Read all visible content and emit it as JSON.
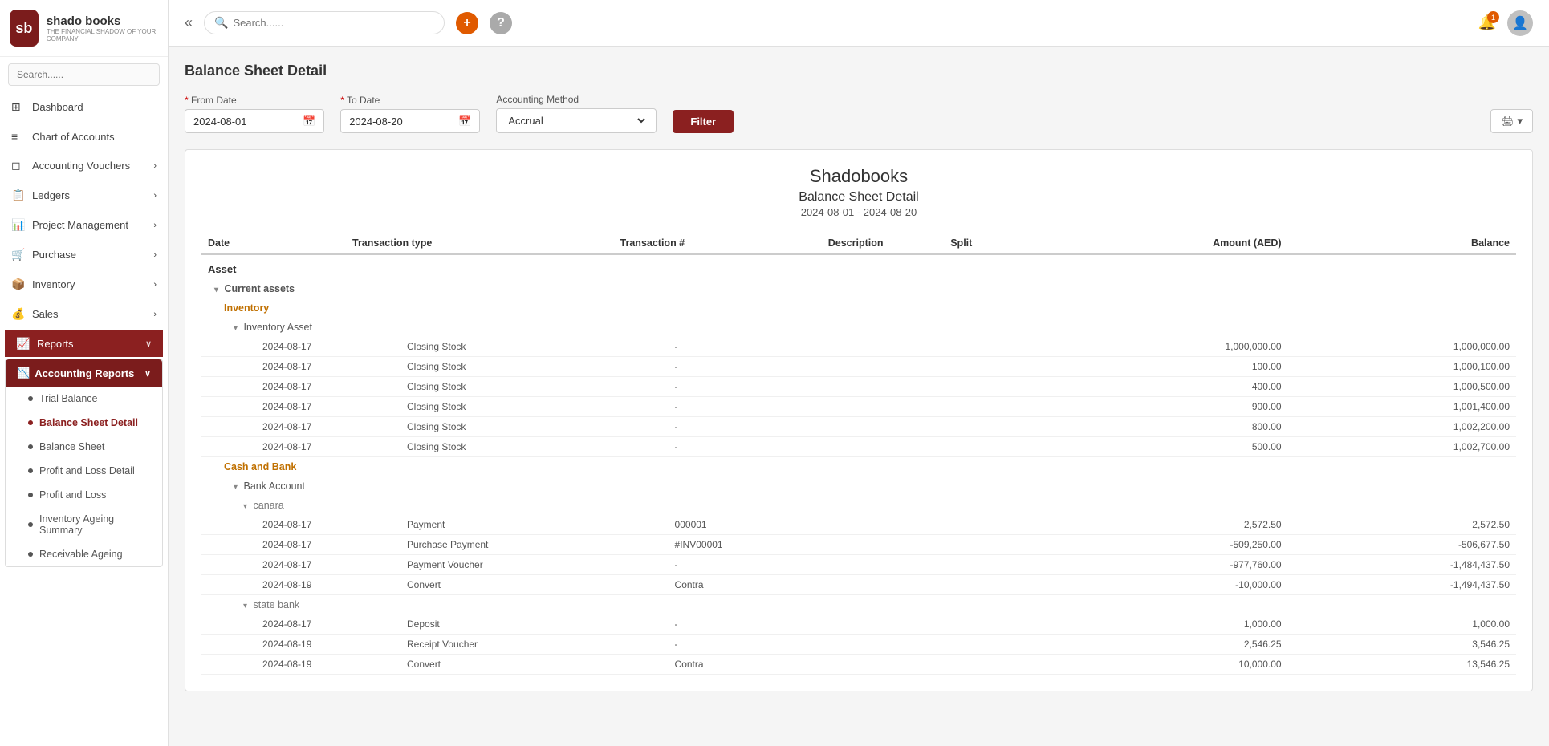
{
  "app": {
    "logo_initials": "sb",
    "logo_brand": "shado books",
    "logo_tagline": "THE FINANCIAL SHADOW OF YOUR COMPANY"
  },
  "sidebar": {
    "search_placeholder": "Search......",
    "nav_items": [
      {
        "id": "dashboard",
        "icon": "⊞",
        "label": "Dashboard",
        "active": false
      },
      {
        "id": "chart-of-accounts",
        "icon": "≡",
        "label": "Chart of Accounts",
        "active": false
      },
      {
        "id": "accounting-vouchers",
        "icon": "☐",
        "label": "Accounting Vouchers",
        "has_chevron": true,
        "active": false
      },
      {
        "id": "ledgers",
        "icon": "📋",
        "label": "Ledgers",
        "has_chevron": true,
        "active": false
      },
      {
        "id": "project-management",
        "icon": "📊",
        "label": "Project Management",
        "has_chevron": true,
        "active": false
      },
      {
        "id": "purchase",
        "icon": "🛒",
        "label": "Purchase",
        "has_chevron": true,
        "active": false
      },
      {
        "id": "inventory",
        "icon": "📦",
        "label": "Inventory",
        "has_chevron": true,
        "active": false
      },
      {
        "id": "sales",
        "icon": "💰",
        "label": "Sales",
        "has_chevron": true,
        "active": false
      },
      {
        "id": "reports",
        "icon": "📈",
        "label": "Reports",
        "has_chevron": true,
        "active": true
      }
    ],
    "accounting_reports": {
      "label": "Accounting Reports",
      "items": [
        {
          "id": "trial-balance",
          "label": "Trial Balance",
          "active": false
        },
        {
          "id": "balance-sheet-detail",
          "label": "Balance Sheet Detail",
          "active": true
        },
        {
          "id": "balance-sheet",
          "label": "Balance Sheet",
          "active": false
        },
        {
          "id": "profit-loss-detail",
          "label": "Profit and Loss Detail",
          "active": false
        },
        {
          "id": "profit-loss",
          "label": "Profit and Loss",
          "active": false
        },
        {
          "id": "inventory-ageing",
          "label": "Inventory Ageing Summary",
          "active": false
        },
        {
          "id": "receivable-ageing",
          "label": "Receivable Ageing",
          "active": false
        }
      ]
    }
  },
  "topbar": {
    "search_placeholder": "Search......",
    "notif_count": "1"
  },
  "page": {
    "title": "Balance Sheet Detail",
    "filter": {
      "from_date_label": "From Date",
      "from_date_value": "2024-08-01",
      "to_date_label": "To Date",
      "to_date_value": "2024-08-20",
      "accounting_method_label": "Accounting Method",
      "accounting_method_value": "Accrual",
      "filter_btn": "Filter",
      "print_btn": "🖨"
    },
    "report": {
      "company": "Shadobooks",
      "title": "Balance Sheet Detail",
      "period": "2024-08-01 - 2024-08-20",
      "columns": [
        "Date",
        "Transaction type",
        "Transaction #",
        "Description",
        "Split",
        "Amount (AED)",
        "Balance"
      ],
      "sections": [
        {
          "type": "section-header",
          "label": "Asset"
        },
        {
          "type": "sub-section",
          "label": "Current assets",
          "collapse": true
        },
        {
          "type": "group-header",
          "label": "Inventory",
          "color": "orange"
        },
        {
          "type": "sub-group",
          "label": "Inventory Asset",
          "collapse": true
        },
        {
          "type": "data-row",
          "date": "2024-08-17",
          "tx_type": "Closing Stock",
          "tx_num": "-",
          "desc": "",
          "split": "",
          "amount": "1,000,000.00",
          "balance": "1,000,000.00"
        },
        {
          "type": "data-row",
          "date": "2024-08-17",
          "tx_type": "Closing Stock",
          "tx_num": "-",
          "desc": "",
          "split": "",
          "amount": "100.00",
          "balance": "1,000,100.00"
        },
        {
          "type": "data-row",
          "date": "2024-08-17",
          "tx_type": "Closing Stock",
          "tx_num": "-",
          "desc": "",
          "split": "",
          "amount": "400.00",
          "balance": "1,000,500.00"
        },
        {
          "type": "data-row",
          "date": "2024-08-17",
          "tx_type": "Closing Stock",
          "tx_num": "-",
          "desc": "",
          "split": "",
          "amount": "900.00",
          "balance": "1,001,400.00"
        },
        {
          "type": "data-row",
          "date": "2024-08-17",
          "tx_type": "Closing Stock",
          "tx_num": "-",
          "desc": "",
          "split": "",
          "amount": "800.00",
          "balance": "1,002,200.00"
        },
        {
          "type": "data-row",
          "date": "2024-08-17",
          "tx_type": "Closing Stock",
          "tx_num": "-",
          "desc": "",
          "split": "",
          "amount": "500.00",
          "balance": "1,002,700.00"
        },
        {
          "type": "group-header",
          "label": "Cash and Bank",
          "color": "orange"
        },
        {
          "type": "sub-group",
          "label": "Bank Account",
          "collapse": true
        },
        {
          "type": "sub-group2",
          "label": "canara",
          "collapse": true
        },
        {
          "type": "data-row",
          "date": "2024-08-17",
          "tx_type": "Payment",
          "tx_num": "000001",
          "desc": "",
          "split": "",
          "amount": "2,572.50",
          "balance": "2,572.50"
        },
        {
          "type": "data-row",
          "date": "2024-08-17",
          "tx_type": "Purchase Payment",
          "tx_num": "#INV00001",
          "desc": "",
          "split": "",
          "amount": "-509,250.00",
          "balance": "-506,677.50"
        },
        {
          "type": "data-row",
          "date": "2024-08-17",
          "tx_type": "Payment Voucher",
          "tx_num": "-",
          "desc": "",
          "split": "",
          "amount": "-977,760.00",
          "balance": "-1,484,437.50"
        },
        {
          "type": "data-row",
          "date": "2024-08-19",
          "tx_type": "Convert",
          "tx_num": "Contra",
          "desc": "",
          "split": "",
          "amount": "-10,000.00",
          "balance": "-1,494,437.50"
        },
        {
          "type": "sub-group2",
          "label": "state bank",
          "collapse": true
        },
        {
          "type": "data-row",
          "date": "2024-08-17",
          "tx_type": "Deposit",
          "tx_num": "-",
          "desc": "",
          "split": "",
          "amount": "1,000.00",
          "balance": "1,000.00"
        },
        {
          "type": "data-row",
          "date": "2024-08-19",
          "tx_type": "Receipt Voucher",
          "tx_num": "-",
          "desc": "",
          "split": "",
          "amount": "2,546.25",
          "balance": "3,546.25"
        },
        {
          "type": "data-row",
          "date": "2024-08-19",
          "tx_type": "Convert",
          "tx_num": "Contra",
          "desc": "",
          "split": "",
          "amount": "10,000.00",
          "balance": "13,546.25"
        }
      ]
    }
  }
}
